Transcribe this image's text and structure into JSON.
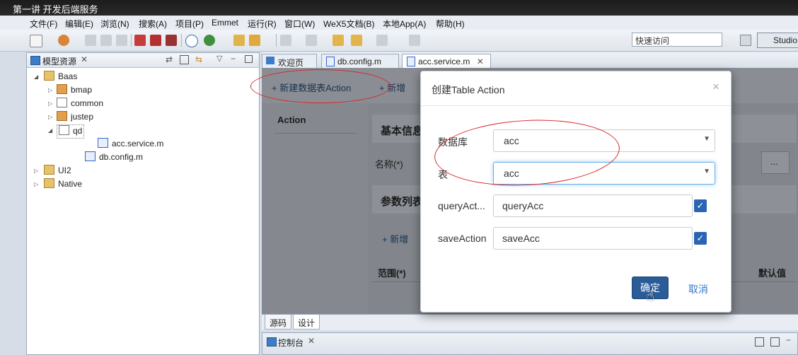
{
  "window": {
    "title": "第一讲 开发后端服务"
  },
  "menu": [
    "文件(F)",
    "编辑(E)",
    "浏览(N)",
    "搜索(A)",
    "项目(P)",
    "Emmet",
    "运行(R)",
    "窗口(W)",
    "WeX5文档(B)",
    "本地App(A)",
    "帮助(H)"
  ],
  "toolbar": {
    "quick_access_placeholder": "快速访问",
    "perspective_label": "Studio"
  },
  "left_panel": {
    "title": "模型资源",
    "tree": [
      {
        "label": "Baas"
      },
      {
        "label": "bmap"
      },
      {
        "label": "common"
      },
      {
        "label": "justep"
      },
      {
        "label": "qd"
      },
      {
        "label": "acc.service.m"
      },
      {
        "label": "db.config.m"
      },
      {
        "label": "UI2"
      },
      {
        "label": "Native"
      }
    ]
  },
  "editor_tabs": [
    {
      "label": "欢迎页"
    },
    {
      "label": "db.config.m"
    },
    {
      "label": "acc.service.m"
    }
  ],
  "editor": {
    "new_table_action": "新建数据表Action",
    "new_action": "新增",
    "side_header": "Action",
    "basic_info": "基本信息",
    "name_label": "名称(*)",
    "params_list": "参数列表",
    "params_add": "新增",
    "range_col": "范围(*)",
    "default_col": "默认值",
    "browse": "..."
  },
  "bottom_tabs": [
    "源码",
    "设计"
  ],
  "console": {
    "title": "控制台"
  },
  "dialog": {
    "title": "创建Table Action",
    "close": "×",
    "fields": {
      "database": {
        "label": "数据库",
        "value": "acc"
      },
      "table": {
        "label": "表",
        "value": "acc"
      },
      "query_action": {
        "label": "queryAct...",
        "value": "queryAcc",
        "checked": true
      },
      "save_action": {
        "label": "saveAction",
        "value": "saveAcc",
        "checked": true
      }
    },
    "ok": "确定",
    "cancel": "取消"
  },
  "colors": {
    "primary": "#2a5c98",
    "annotation": "#d8262a",
    "link": "#3579c6"
  }
}
